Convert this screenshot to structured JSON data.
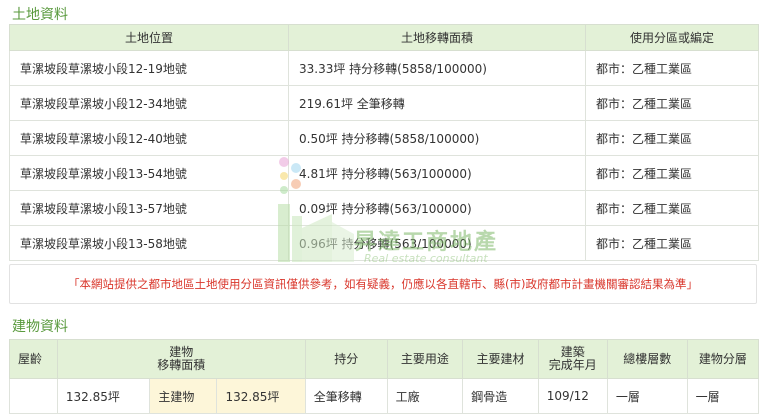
{
  "land": {
    "title": "土地資料",
    "headers": [
      "土地位置",
      "土地移轉面積",
      "使用分區或編定"
    ],
    "rows": [
      {
        "location": "草漯坡段草漯坡小段12-19地號",
        "area": "33.33坪 持分移轉(5858/100000)",
        "zoning": "都市：乙種工業區"
      },
      {
        "location": "草漯坡段草漯坡小段12-34地號",
        "area": "219.61坪 全筆移轉",
        "zoning": "都市：乙種工業區"
      },
      {
        "location": "草漯坡段草漯坡小段12-40地號",
        "area": "0.50坪 持分移轉(5858/100000)",
        "zoning": "都市：乙種工業區"
      },
      {
        "location": "草漯坡段草漯坡小段13-54地號",
        "area": "4.81坪 持分移轉(563/100000)",
        "zoning": "都市：乙種工業區"
      },
      {
        "location": "草漯坡段草漯坡小段13-57地號",
        "area": "0.09坪 持分移轉(563/100000)",
        "zoning": "都市：乙種工業區"
      },
      {
        "location": "草漯坡段草漯坡小段13-58地號",
        "area": "0.96坪 持分移轉(563/100000)",
        "zoning": "都市：乙種工業區"
      }
    ]
  },
  "notice": "「本網站提供之都市地區土地使用分區資訊僅供參考，如有疑義，仍應以各直轄市、縣(市)政府都市計畫機關審認結果為準」",
  "watermark": {
    "name": "昇達工商地產",
    "sub": "Real estate consultant"
  },
  "building": {
    "title": "建物資料",
    "headers": {
      "age": "屋齡",
      "area_l1": "建物",
      "area_l2": "移轉面積",
      "share": "持分",
      "use": "主要用途",
      "material": "主要建材",
      "completed_l1": "建築",
      "completed_l2": "完成年月",
      "total_floors": "總樓層數",
      "floor": "建物分層"
    },
    "row": {
      "age": "",
      "total_area": "132.85坪",
      "main_label": "主建物",
      "main_area": "132.85坪",
      "share": "全筆移轉",
      "use": "工廠",
      "material": "鋼骨造",
      "completed": "109/12",
      "total_floors": "一層",
      "floor": "一層"
    }
  },
  "colors": {
    "accent_green": "#5a9a3e",
    "header_bg": "#e3f1d7",
    "notice_red": "#d9362b",
    "highlight": "#fdf6d9"
  }
}
